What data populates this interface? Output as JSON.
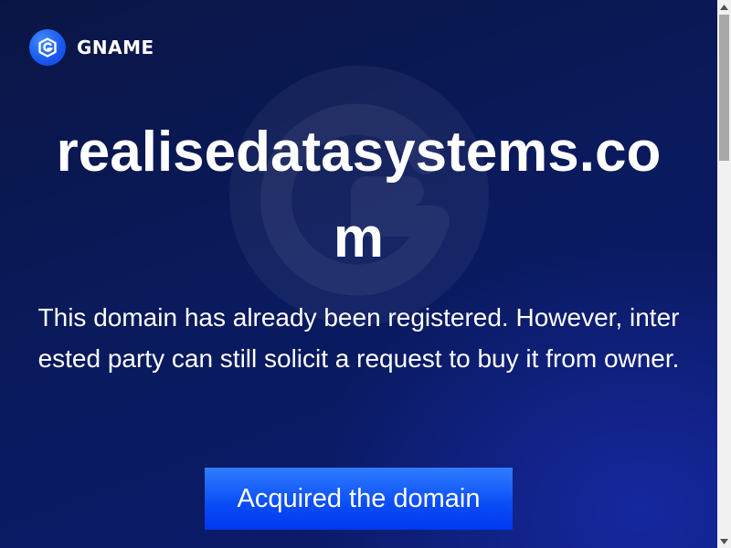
{
  "header": {
    "brand_name": "GNAME",
    "logo_icon": "gname-logo-icon"
  },
  "main": {
    "domain": "realisedatasystems.com",
    "description": "This domain has already been registered. However, interested party can still solicit a request to buy it from owner.",
    "cta_label": "Acquired the domain"
  },
  "colors": {
    "background": "#0a1a5c",
    "accent": "#1a56f0",
    "button": "#0a4cf5",
    "text": "#ffffff"
  },
  "scrollbar": {
    "icons": [
      "scroll-up-arrow-icon",
      "scroll-down-arrow-icon"
    ]
  }
}
